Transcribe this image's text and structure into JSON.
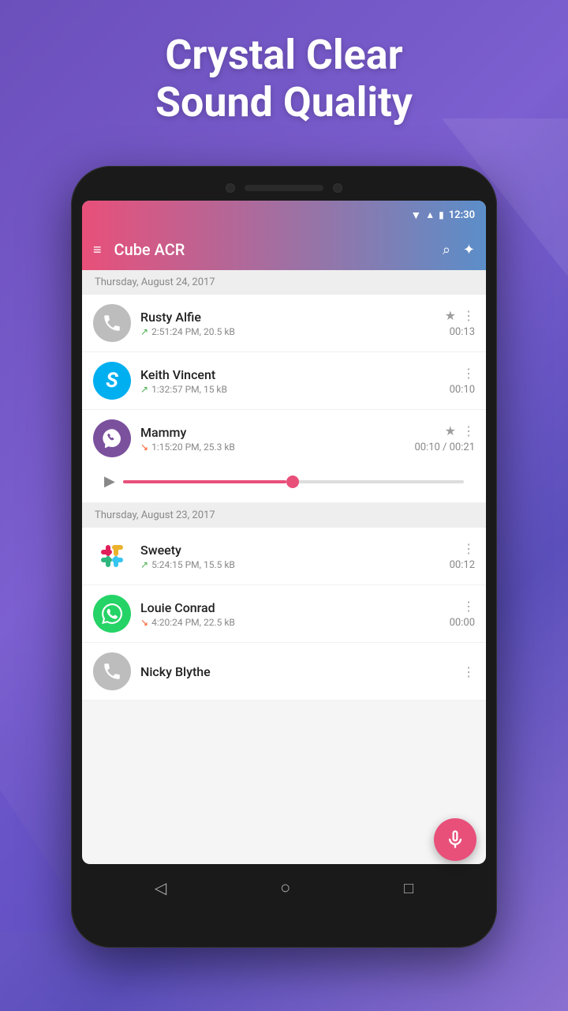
{
  "header": {
    "line1": "Crystal Clear",
    "line2": "Sound Quality"
  },
  "statusBar": {
    "time": "12:30",
    "icons": {
      "wifi": "▼",
      "signal": "▲",
      "battery": "🔋"
    }
  },
  "toolbar": {
    "title": "Cube ACR",
    "menuIcon": "≡",
    "searchIcon": "⌕",
    "starIcon": "☆"
  },
  "sections": [
    {
      "date": "Thursday, August 24, 2017",
      "calls": [
        {
          "name": "Rusty Alfie",
          "avatarType": "phone",
          "direction": "out",
          "detail": "2:51:24 PM, 20.5 kB",
          "duration": "00:13",
          "starred": true,
          "hasMore": true
        },
        {
          "name": "Keith Vincent",
          "avatarType": "skype",
          "direction": "out",
          "detail": "1:32:57 PM, 15 kB",
          "duration": "00:10",
          "starred": false,
          "hasMore": true
        },
        {
          "name": "Mammy",
          "avatarType": "viber",
          "direction": "in",
          "detail": "1:15:20 PM, 25.3 kB",
          "duration": "00:10 / 00:21",
          "starred": true,
          "hasMore": true,
          "playing": true
        }
      ]
    },
    {
      "date": "Thursday, August 23, 2017",
      "calls": [
        {
          "name": "Sweety",
          "avatarType": "slack",
          "direction": "out",
          "detail": "5:24:15 PM, 15.5 kB",
          "duration": "00:12",
          "starred": false,
          "hasMore": true
        },
        {
          "name": "Louie Conrad",
          "avatarType": "whatsapp",
          "direction": "in",
          "detail": "4:20:24 PM, 22.5 kB",
          "duration": "00:00",
          "starred": false,
          "hasMore": true
        },
        {
          "name": "Nicky Blythe",
          "avatarType": "phone",
          "direction": "out",
          "detail": "",
          "duration": "",
          "starred": false,
          "hasMore": true
        }
      ]
    }
  ],
  "fab": {
    "icon": "🎤"
  },
  "nav": {
    "back": "◁",
    "home": "○",
    "recents": "□"
  }
}
